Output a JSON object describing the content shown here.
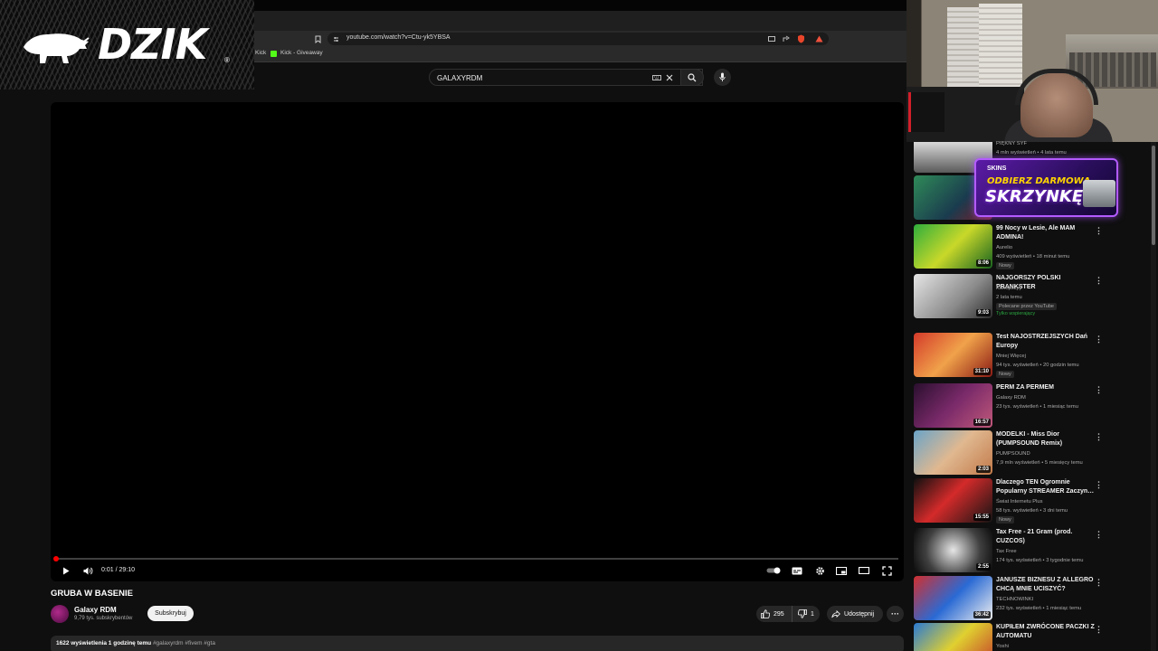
{
  "overlay": {
    "brand": "DZIK",
    "reg": "®"
  },
  "browser": {
    "url": "youtube.com/watch?v=Ctu-yk5YBSA",
    "bookmarks": [
      {
        "label": "Kick"
      },
      {
        "label": "Kick - Giveaway"
      }
    ]
  },
  "youtube": {
    "search_query": "GALAXYRDM",
    "player": {
      "current_time": "0:01 / 29:10",
      "progress_fraction": 0.001
    },
    "video": {
      "title": "GRUBA W BASENIE",
      "channel": "Galaxy RDM",
      "subscribers": "9,79 tys. subskrybentów",
      "subscribe_label": "Subskrybuj",
      "likes": "295",
      "dislikes": "1",
      "share_label": "Udostępnij",
      "views_line": "1622 wyświetlenia  1 godzinę temu",
      "hashtags": "#galaxyrdm #fivem #gta"
    }
  },
  "ad": {
    "top": "SKINS",
    "line1": "ODBIERZ DARMOWĄ",
    "line2": "SKRZYNKĘ!"
  },
  "sidebar": {
    "partial_top": {
      "channel": "PIĘKNY SYF",
      "meta": "4 mln wyświetleń • 4 lata temu"
    },
    "items": [
      {
        "title": "99 Nocy w Lesie, Ale MAM ADMINA!",
        "channel": "Aurelio",
        "meta": "409 wyświetleń • 18 minut temu",
        "duration": "8:06",
        "badge": "Nowy"
      },
      {
        "title": "NAJGORSZY POLSKI PRANKSTER",
        "channel": "Konopskyy",
        "meta": "2 lata temu",
        "duration": "9:03",
        "extra": "Polecane przez YouTube",
        "members": "Tylko wspierający"
      },
      {
        "title": "Test NAJOSTRZEJSZYCH Dań Europy",
        "channel": "Mniej Więcej",
        "meta": "94 tys. wyświetleń • 20 godzin temu",
        "duration": "31:10",
        "badge": "Nowy"
      },
      {
        "title": "PERM ZA PERMEM",
        "channel": "Galaxy RDM",
        "meta": "23 tys. wyświetleń • 1 miesiąc temu",
        "duration": "16:57"
      },
      {
        "title": "MODELKI - Miss Dior (PUMPSOUND Remix)",
        "channel": "PUMPSOUND",
        "meta": "7,9 mln wyświetleń • 5 miesięcy temu",
        "duration": "2:03"
      },
      {
        "title": "Dlaczego TEN Ogromnie Popularny STREAMER Zaczyn…",
        "channel": "Świat Internetu Plus",
        "meta": "58 tys. wyświetleń • 3 dni temu",
        "duration": "15:55",
        "badge": "Nowy"
      },
      {
        "title": "Tax Free - 21 Gram (prod. CUZCOS)",
        "channel": "Tax Free",
        "meta": "174 tys. wyświetleń • 3 tygodnie temu",
        "duration": "2:55"
      },
      {
        "title": "JANUSZE BIZNESU Z ALLEGRO CHCĄ MNIE UCISZYĆ?",
        "channel": "TECHNOWINKI",
        "meta": "232 tys. wyświetleń • 1 miesiąc temu",
        "duration": "36:42"
      },
      {
        "title": "KUPIŁEM ZWRÓCONE PACZKI Z AUTOMATU",
        "channel": "Yoshi",
        "meta": "",
        "duration": ""
      }
    ]
  }
}
